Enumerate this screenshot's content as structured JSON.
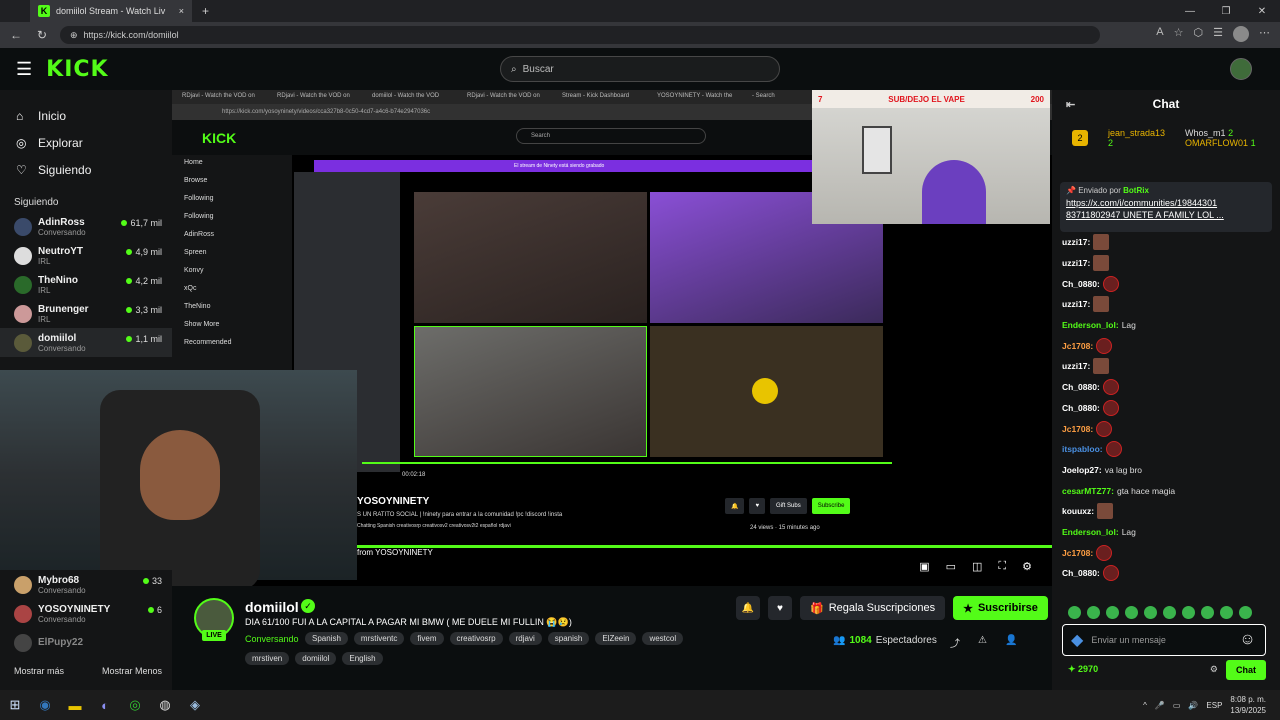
{
  "browser": {
    "tab_title": "domiilol Stream - Watch Liv",
    "tab_close": "×",
    "new_tab": "+",
    "url": "https://kick.com/domiilol"
  },
  "kick_header": {
    "logo": "KICK",
    "search_placeholder": "Buscar"
  },
  "sidebar": {
    "nav": [
      {
        "label": "Inicio",
        "icon": "home-icon"
      },
      {
        "label": "Explorar",
        "icon": "compass-icon"
      },
      {
        "label": "Siguiendo",
        "icon": "heart-icon"
      }
    ],
    "following_title": "Siguiendo",
    "channels": [
      {
        "name": "AdinRoss",
        "status": "Conversando",
        "viewers": "61,7 mil"
      },
      {
        "name": "NeutroYT",
        "status": "IRL",
        "viewers": "4,9 mil"
      },
      {
        "name": "TheNino",
        "status": "IRL",
        "viewers": "4,2 mil"
      },
      {
        "name": "Brunenger",
        "status": "IRL",
        "viewers": "3,3 mil"
      },
      {
        "name": "domiilol",
        "status": "Conversando",
        "viewers": "1,1 mil"
      }
    ],
    "bottom_channels": [
      {
        "name": "Mybro68",
        "status": "Conversando",
        "viewers": "33"
      },
      {
        "name": "YOSOYNINETY",
        "status": "Conversando",
        "viewers": "6"
      },
      {
        "name": "ElPupy22",
        "status": "",
        "viewers": ""
      }
    ],
    "show_more": "Mostrar más",
    "show_less": "Mostrar Menos"
  },
  "inner_screen": {
    "tabs": [
      "RDjavi - Watch the VOD on",
      "RDjavi - Watch the VOD on",
      "domiilol - Watch the VOD",
      "RDjavi - Watch the VOD on",
      "Stream - Kick Dashboard",
      "YOSOYNINETY - Watch the",
      "- Search"
    ],
    "url": "https://kick.com/yosoyninety/videos/cca327b8-0c50-4cd7-a4c6-b74e2947036c",
    "logo": "KICK",
    "search": "Search",
    "side": [
      "Home",
      "Browse",
      "Following",
      "Following",
      "AdinRoss",
      "Spreen",
      "Konvy",
      "xQc",
      "TheNino",
      "Show More",
      "Recommended"
    ],
    "banner": "El stream de Ninety está siendo grabado",
    "time": "00:02:18",
    "title": "YOSOYNINETY",
    "subtitle": "S UN RATITO SOCIAL | !ninety para entrar a la comunidad !pc !discord !insta",
    "tags": "Chatting   Spanish   creativosrp   creativosv2   creativosv2t2   español   rdjavi",
    "gift": "Gift Subs",
    "subscribe": "Subscribe",
    "views": "24 views · 15 minutes ago",
    "from": "from YOSOYNINETY"
  },
  "overlay": {
    "left_num": "7",
    "title": "SUB/DEJO EL VAPE",
    "right_num": "200"
  },
  "stream_info": {
    "channel": "domiilol",
    "live": "LIVE",
    "title": "DIA 61/100 FUI A LA CAPITAL A PAGAR MI BMW ( ME DUELE MI FULLIN 😭😢)",
    "category": "Conversando",
    "tags": [
      "Spanish",
      "mrstiventc",
      "fivem",
      "creativosrp",
      "rdjavi",
      "spanish",
      "ElZeein",
      "westcol"
    ],
    "tags2": [
      "mrstiven",
      "domiilol",
      "English"
    ],
    "gift_label": "Regala Suscripciones",
    "subscribe_label": "Suscribirse",
    "viewer_count": "1084",
    "viewer_label": "Espectadores"
  },
  "chat": {
    "title": "Chat",
    "leader1": {
      "name": "jean_strada13",
      "count": "2"
    },
    "leader2": {
      "name": "Whos_m1",
      "count": "2"
    },
    "leader3": {
      "name": "OMARFLOW01",
      "count": "1"
    },
    "leader_rank": "2",
    "pinned_by_prefix": "Enviado por",
    "pinned_by": "BotRix",
    "pinned_link": "https://x.com/i/communities/19844301 83711802947",
    "pinned_text": "UNETE A FAMILY LOL ...",
    "messages": [
      {
        "user": "uzzi17:",
        "text": "",
        "color": "#ffffff",
        "emote": "sq"
      },
      {
        "user": "uzzi17:",
        "text": "",
        "color": "#ffffff",
        "emote": "sq"
      },
      {
        "user": "Ch_0880:",
        "text": "",
        "color": "#ffffff",
        "emote": "round"
      },
      {
        "user": "uzzi17:",
        "text": "",
        "color": "#ffffff",
        "emote": "sq"
      },
      {
        "user": "Enderson_lol:",
        "text": "Lag",
        "color": "#53fc18",
        "emote": ""
      },
      {
        "user": "Jc1708:",
        "text": "",
        "color": "#ff9f43",
        "emote": "round"
      },
      {
        "user": "uzzi17:",
        "text": "",
        "color": "#ffffff",
        "emote": "sq"
      },
      {
        "user": "Ch_0880:",
        "text": "",
        "color": "#ffffff",
        "emote": "round"
      },
      {
        "user": "Ch_0880:",
        "text": "",
        "color": "#ffffff",
        "emote": "round"
      },
      {
        "user": "Jc1708:",
        "text": "",
        "color": "#ff9f43",
        "emote": "round"
      },
      {
        "user": "itspabloo:",
        "text": "",
        "color": "#4a90e2",
        "emote": "round"
      },
      {
        "user": "Joelop27:",
        "text": "va lag bro",
        "color": "#ffffff",
        "emote": ""
      },
      {
        "user": "cesarMTZ77:",
        "text": "gta hace magia",
        "color": "#53fc18",
        "emote": ""
      },
      {
        "user": "kouuxz:",
        "text": "",
        "color": "#ffffff",
        "emote": "sq"
      },
      {
        "user": "Enderson_lol:",
        "text": "Lag",
        "color": "#53fc18",
        "emote": ""
      },
      {
        "user": "Jc1708:",
        "text": "",
        "color": "#ff9f43",
        "emote": "round"
      },
      {
        "user": "Ch_0880:",
        "text": "",
        "color": "#ffffff",
        "emote": "round"
      }
    ],
    "input_placeholder": "Enviar un mensaje",
    "points": "2970",
    "chat_button": "Chat"
  },
  "taskbar": {
    "lang": "ESP",
    "time": "8:08 p. m.",
    "date": "13/9/2025"
  }
}
